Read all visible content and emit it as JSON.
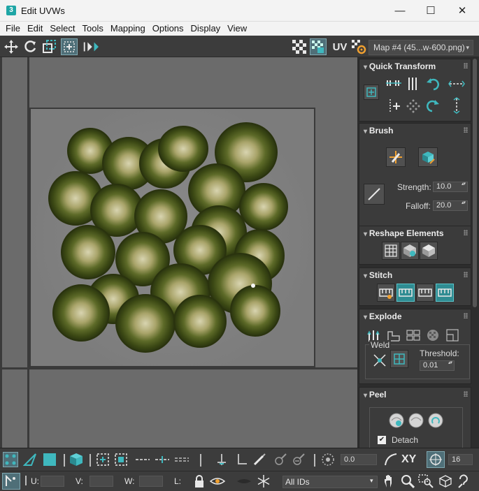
{
  "window": {
    "app_icon_glyph": "3",
    "title": "Edit UVWs",
    "minimize_glyph": "—",
    "maximize_glyph": "☐",
    "close_glyph": "✕"
  },
  "menu": [
    "File",
    "Edit",
    "Select",
    "Tools",
    "Mapping",
    "Options",
    "Display",
    "View"
  ],
  "toolbar": {
    "uv_label": "UV",
    "map_dropdown": "Map #4 (45...w-600.png)",
    "dropdown_arrow": "▾"
  },
  "panel": {
    "quick_transform": {
      "title": "Quick Transform"
    },
    "brush": {
      "title": "Brush",
      "strength_label": "Strength:",
      "strength_value": "10.0",
      "falloff_label": "Falloff:",
      "falloff_value": "20.0"
    },
    "reshape": {
      "title": "Reshape Elements"
    },
    "stitch": {
      "title": "Stitch"
    },
    "explode": {
      "title": "Explode",
      "weld_label": "Weld",
      "threshold_label": "Threshold:",
      "threshold_value": "0.01"
    },
    "peel": {
      "title": "Peel",
      "detach_check": "✔",
      "detach_label": "Detach",
      "detach_checked": true
    }
  },
  "bottom": {
    "xy_label": "XY",
    "angle_value": "0.0",
    "snap_value": "16",
    "u_label": "U:",
    "v_label": "V:",
    "w_label": "W:",
    "l_label": "L:",
    "ids_dropdown": "All IDs",
    "ids_arrow": "▾"
  },
  "colors": {
    "accent_teal": "#3fb8be",
    "panel_bg": "#3b3b3b",
    "viewport_bg": "#6b6b6b"
  }
}
